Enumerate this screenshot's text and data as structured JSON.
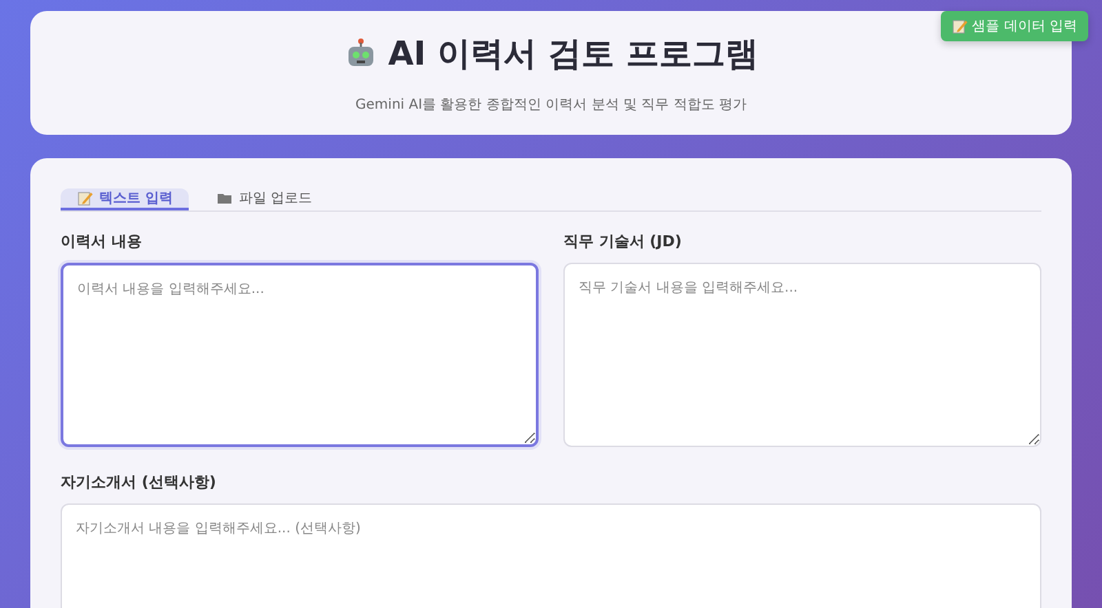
{
  "sample_button": {
    "label": "샘플 데이터 입력"
  },
  "header": {
    "title": "AI 이력서 검토 프로그램",
    "subtitle": "Gemini AI를 활용한 종합적인 이력서 분석 및 직무 적합도 평가"
  },
  "tabs": [
    {
      "label": "텍스트 입력",
      "selected": true,
      "kind": "pencil"
    },
    {
      "label": "파일 업로드",
      "selected": false,
      "kind": "folder"
    }
  ],
  "fields": [
    {
      "label": "이력서 내용",
      "placeholder": "이력서 내용을 입력해주세요...",
      "focused": true
    },
    {
      "label": "직무 기술서 (JD)",
      "placeholder": "직무 기술서 내용을 입력해주세요...",
      "focused": false
    },
    {
      "label": "자기소개서 (선택사항)",
      "placeholder": "자기소개서 내용을 입력해주세요... (선택사항)",
      "focused": false
    }
  ]
}
